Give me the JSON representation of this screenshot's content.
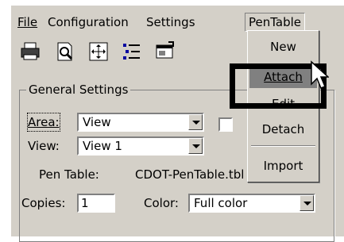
{
  "menubar": {
    "file": "File",
    "configuration": "Configuration",
    "settings": "Settings",
    "pentable": "PenTable"
  },
  "toolbar": {
    "icons": [
      "printer-icon",
      "print-preview-icon",
      "fit-view-icon",
      "list-icon",
      "document-icon"
    ]
  },
  "general_settings": {
    "title": "General Settings",
    "area_label": "Area:",
    "area_value": "View",
    "view_label": "View:",
    "view_value": "View 1",
    "pen_table_label": "Pen Table:",
    "pen_table_value": "CDOT-PenTable.tbl",
    "copies_label": "Copies:",
    "copies_value": "1",
    "color_label": "Color:",
    "color_value": "Full color"
  },
  "pentable_menu": {
    "new": "New",
    "attach": "Attach",
    "edit": "Edit",
    "detach": "Detach",
    "import": "Import"
  },
  "colors": {
    "face": "#d4d0c8",
    "highlight": "#808080",
    "annotation": "#000000"
  }
}
